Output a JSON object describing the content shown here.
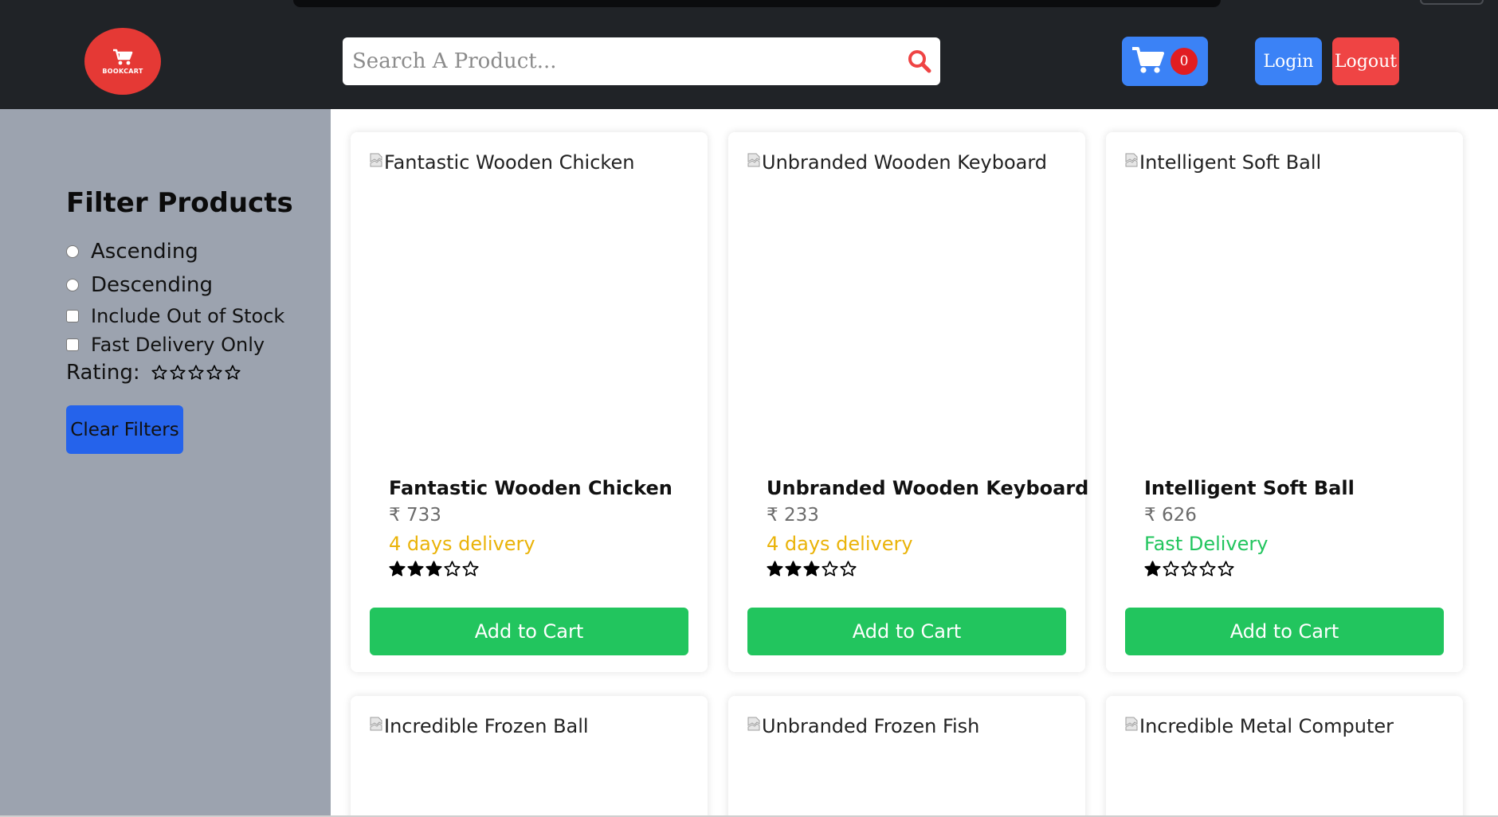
{
  "header": {
    "logo_text": "BOOKCART",
    "search_placeholder": "Search A Product...",
    "cart_count": "0",
    "login_label": "Login",
    "logout_label": "Logout"
  },
  "sidebar": {
    "title": "Filter Products",
    "options": [
      {
        "label": "Ascending",
        "type": "radio",
        "checked": false
      },
      {
        "label": "Descending",
        "type": "radio",
        "checked": false
      },
      {
        "label": "Include Out of Stock",
        "type": "checkbox",
        "checked": false
      },
      {
        "label": "Fast Delivery Only",
        "type": "checkbox",
        "checked": false
      }
    ],
    "rating_label": "Rating:",
    "rating_value": 0,
    "rating_max": 5,
    "clear_label": "Clear Filters"
  },
  "products": [
    {
      "name": "Fantastic Wooden Chicken",
      "alt": "Fantastic Wooden Chicken",
      "price": "₹ 733",
      "delivery": "4 days delivery",
      "delivery_color": "#eab308",
      "rating": 3,
      "button": "Add to Cart"
    },
    {
      "name": "Unbranded Wooden Keyboard",
      "alt": "Unbranded Wooden Keyboard",
      "price": "₹ 233",
      "delivery": "4 days delivery",
      "delivery_color": "#eab308",
      "rating": 3,
      "button": "Add to Cart"
    },
    {
      "name": "Intelligent Soft Ball",
      "alt": "Intelligent Soft Ball",
      "price": "₹ 626",
      "delivery": "Fast Delivery",
      "delivery_color": "#22c55e",
      "rating": 1,
      "button": "Add to Cart"
    },
    {
      "alt": "Incredible Frozen Ball"
    },
    {
      "alt": "Unbranded Frozen Fish"
    },
    {
      "alt": "Incredible Metal Computer"
    }
  ],
  "colors": {
    "header_bg": "#202327",
    "sidebar_bg": "#9ca3af",
    "logo_red": "#e53935",
    "primary_blue": "#3b82f6",
    "danger_red": "#ef4444",
    "success_green": "#22c55e"
  },
  "icons": {
    "logo": "shopping-cart-icon",
    "search": "magnifier-icon",
    "cart": "shopping-cart-icon",
    "star_filled": "star-filled-icon",
    "star_empty": "star-outline-icon",
    "broken_image": "broken-image-icon"
  }
}
